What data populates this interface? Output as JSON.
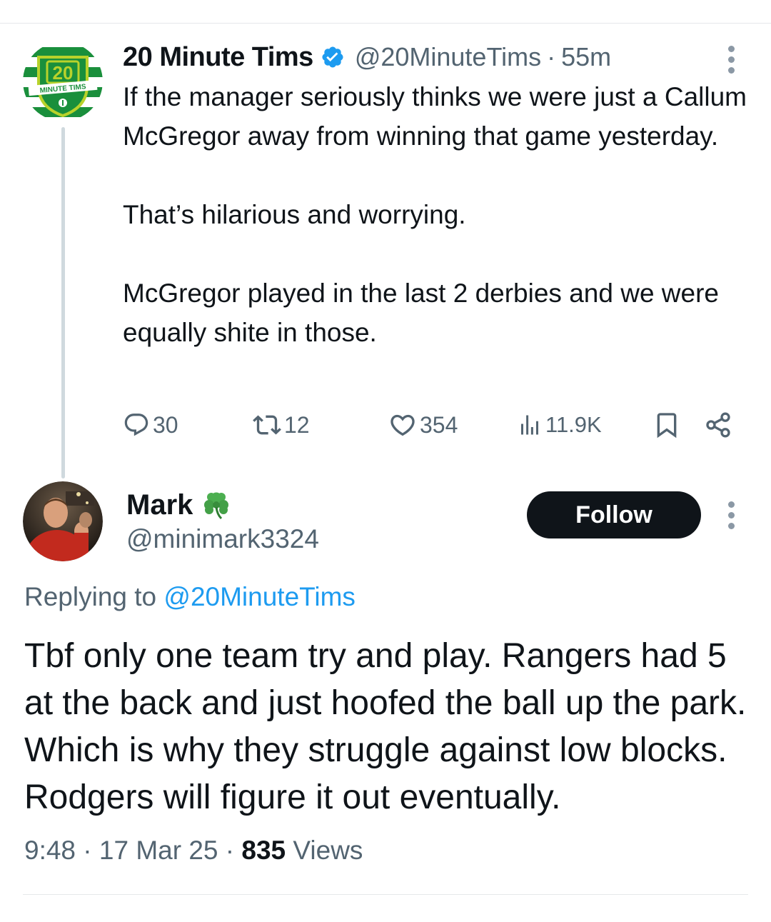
{
  "parent_tweet": {
    "author_name": "20 Minute Tims",
    "verified": true,
    "handle": "@20MinuteTims",
    "separator": "·",
    "time": "55m",
    "avatar": {
      "badge_text": "20",
      "banner_text": "MINUTE TIMS",
      "colors": [
        "#1a8f3c",
        "#ffffff",
        "#b8d22b"
      ]
    },
    "body_paragraphs": [
      "If the manager seriously thinks we were just a Callum McGregor away from winning that game yesterday.",
      "That’s hilarious and worrying.",
      "McGregor played in the last 2 derbies and we were equally shite in those."
    ],
    "actions": {
      "replies": "30",
      "retweets": "12",
      "likes": "354",
      "views": "11.9K"
    },
    "icons": [
      "verified-icon",
      "reply-icon",
      "retweet-icon",
      "like-icon",
      "views-icon",
      "bookmark-icon",
      "share-icon",
      "more-icon"
    ]
  },
  "reply_tweet": {
    "author_name": "Mark",
    "name_emoji": "shamrock",
    "handle": "@minimark3324",
    "follow_label": "Follow",
    "replying_prefix": "Replying to",
    "replying_to": "@20MinuteTims",
    "body": "Tbf only one team try and play. Rangers had 5 at the back and just hoofed the ball up the park. Which is why they struggle against low blocks. Rodgers will figure it out eventually.",
    "time": "9:48",
    "separator": "·",
    "date": "17 Mar 25",
    "views_count": "835",
    "views_label": "Views"
  },
  "colors": {
    "text": "#0f1419",
    "secondary": "#536471",
    "link": "#1d9bf0",
    "verified": "#1d9bf0",
    "follow_bg": "#0f1419",
    "thread_line": "#cfd9de"
  }
}
